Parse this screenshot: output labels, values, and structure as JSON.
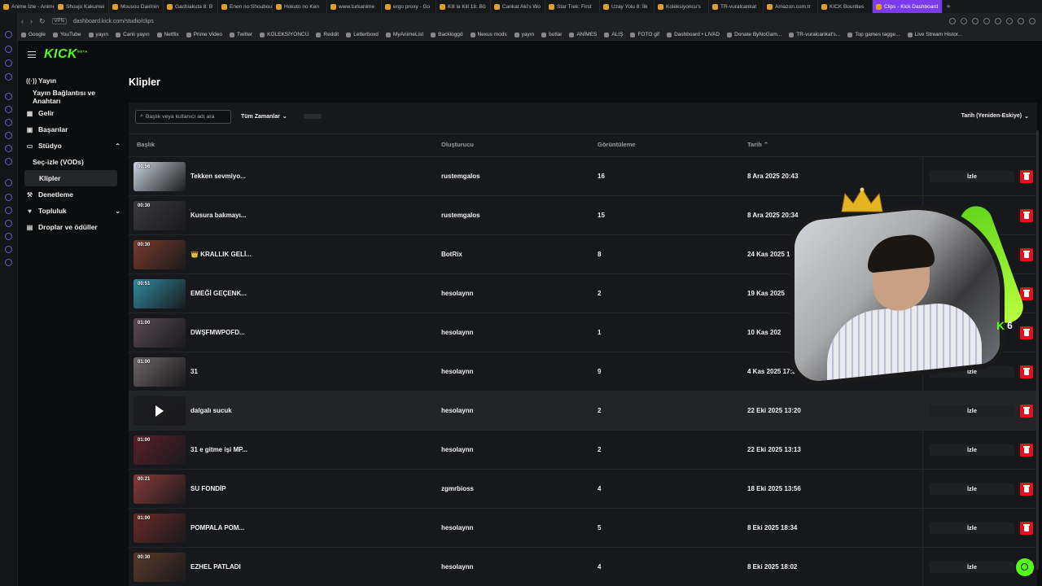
{
  "browser": {
    "tabs": [
      {
        "title": "Anime İzle - Anime"
      },
      {
        "title": "Shoujo Kakumei"
      },
      {
        "title": "Mousou Dairinin"
      },
      {
        "title": "Gachiakuta 8. B"
      },
      {
        "title": "Enen no Shouboutai"
      },
      {
        "title": "Hokuto no Ken"
      },
      {
        "title": "www.turkanime"
      },
      {
        "title": "ergo proxy - Go"
      },
      {
        "title": "Kill la Kill 18. Bö"
      },
      {
        "title": "Cankat Aki's Wo"
      },
      {
        "title": "Star Trek: First"
      },
      {
        "title": "Uzay Yolu 8: İlk"
      },
      {
        "title": "Koleksiyoncu's"
      },
      {
        "title": "TR-vuralcankat"
      },
      {
        "title": "Amazon.com.tr"
      },
      {
        "title": "KICK Bounties"
      },
      {
        "title": "Clips - Kick Dashboard"
      }
    ],
    "new_tab": "+",
    "url": "dashboard.kick.com/studio/clips",
    "vpn_label": "VPN",
    "bookmarks": [
      "Google",
      "YouTube",
      "yayın",
      "Canlı yayın",
      "Netflix",
      "Prime Video",
      "Twitter",
      "KOLEKSİYONCU",
      "Reddit",
      "Letterboxd",
      "MyAnimeList",
      "Backloggd",
      "Nexus mods",
      "yayın",
      "botlar",
      "ANİMES",
      "ALIŞ",
      "FOTO gif",
      "Dashboard • LIVAD",
      "Donate ByNoGam...",
      "TR-vuralcankat's...",
      "Top games tagge...",
      "Live Stream Histor..."
    ]
  },
  "app": {
    "logo": "KICK",
    "logo_beta": "BETA"
  },
  "sidebar": {
    "items": [
      {
        "label": "Yayın",
        "icon": "broadcast-icon"
      },
      {
        "label": "Yayın Bağlantısı ve Anahtarı"
      },
      {
        "label": "Gelir",
        "icon": "revenue-icon"
      },
      {
        "label": "Başarılar",
        "icon": "trophy-icon"
      },
      {
        "label": "Stüdyo",
        "icon": "studio-icon"
      },
      {
        "label": "Seç-izle (VODs)"
      },
      {
        "label": "Klipler"
      },
      {
        "label": "Denetleme",
        "icon": "moderation-icon"
      },
      {
        "label": "Topluluk",
        "icon": "community-icon"
      },
      {
        "label": "Droplar ve ödüller",
        "icon": "drops-icon"
      }
    ]
  },
  "page": {
    "title": "Klipler",
    "search_placeholder": "Başlık veya kullanıcı adı ara",
    "time_filter": "Tüm Zamanlar",
    "sort": "Tarih (Yeniden-Eskiye)",
    "columns": {
      "title": "Başlık",
      "creator": "Oluşturucu",
      "views": "Görüntüleme",
      "date": "Tarih"
    },
    "watch_label": "İzle"
  },
  "clips": [
    {
      "duration": "00:56",
      "title": "Tekken sevmiyo...",
      "creator": "rustemgalos",
      "views": "16",
      "date": "8 Ara 2025 20:43",
      "thumb": "#c9d3e0"
    },
    {
      "duration": "00:30",
      "title": "Kusura bakmayı...",
      "creator": "rustemgalos",
      "views": "15",
      "date": "8 Ara 2025 20:34",
      "thumb": "#3a3b3e"
    },
    {
      "duration": "00:30",
      "title": "👑 KRALLIK GELİ...",
      "creator": "BotRix",
      "views": "8",
      "date": "24 Kas 2025 1",
      "thumb": "#7a3b2c"
    },
    {
      "duration": "00:51",
      "title": "EMEĞİ GEÇENK...",
      "creator": "hesolaynn",
      "views": "2",
      "date": "19 Kas 2025",
      "thumb": "#2f8aa0"
    },
    {
      "duration": "01:00",
      "title": "DWŞFMWPOFD...",
      "creator": "hesolaynn",
      "views": "1",
      "date": "10 Kas 202",
      "thumb": "#5b4a52"
    },
    {
      "duration": "01:00",
      "title": "31",
      "creator": "hesolaynn",
      "views": "9",
      "date": "4 Kas 2025 17:38",
      "thumb": "#6e6566"
    },
    {
      "duration": "",
      "title": "dalgalı sucuk",
      "creator": "hesolaynn",
      "views": "2",
      "date": "22 Eki 2025 13:20",
      "thumb": "#1b1c1e"
    },
    {
      "duration": "01:00",
      "title": "31 e gitme işi MP...",
      "creator": "hesolaynn",
      "views": "2",
      "date": "22 Eki 2025 13:13",
      "thumb": "#5a1f2c"
    },
    {
      "duration": "00:21",
      "title": "SU FONDİP",
      "creator": "zgmrbioss",
      "views": "4",
      "date": "18 Eki 2025 13:56",
      "thumb": "#8a3a3a"
    },
    {
      "duration": "01:00",
      "title": "POMPALA POM...",
      "creator": "hesolaynn",
      "views": "5",
      "date": "8 Eki 2025 18:34",
      "thumb": "#6a2a26"
    },
    {
      "duration": "00:30",
      "title": "EZHEL PATLADI",
      "creator": "hesolaynn",
      "views": "4",
      "date": "8 Eki 2025 18:02",
      "thumb": "#5a3a2a"
    }
  ],
  "overlay": {
    "kick_count": "6"
  },
  "colors": {
    "kick_green": "#53fc18",
    "delete_red": "#e0121b",
    "active_tab": "#7c3aed"
  }
}
